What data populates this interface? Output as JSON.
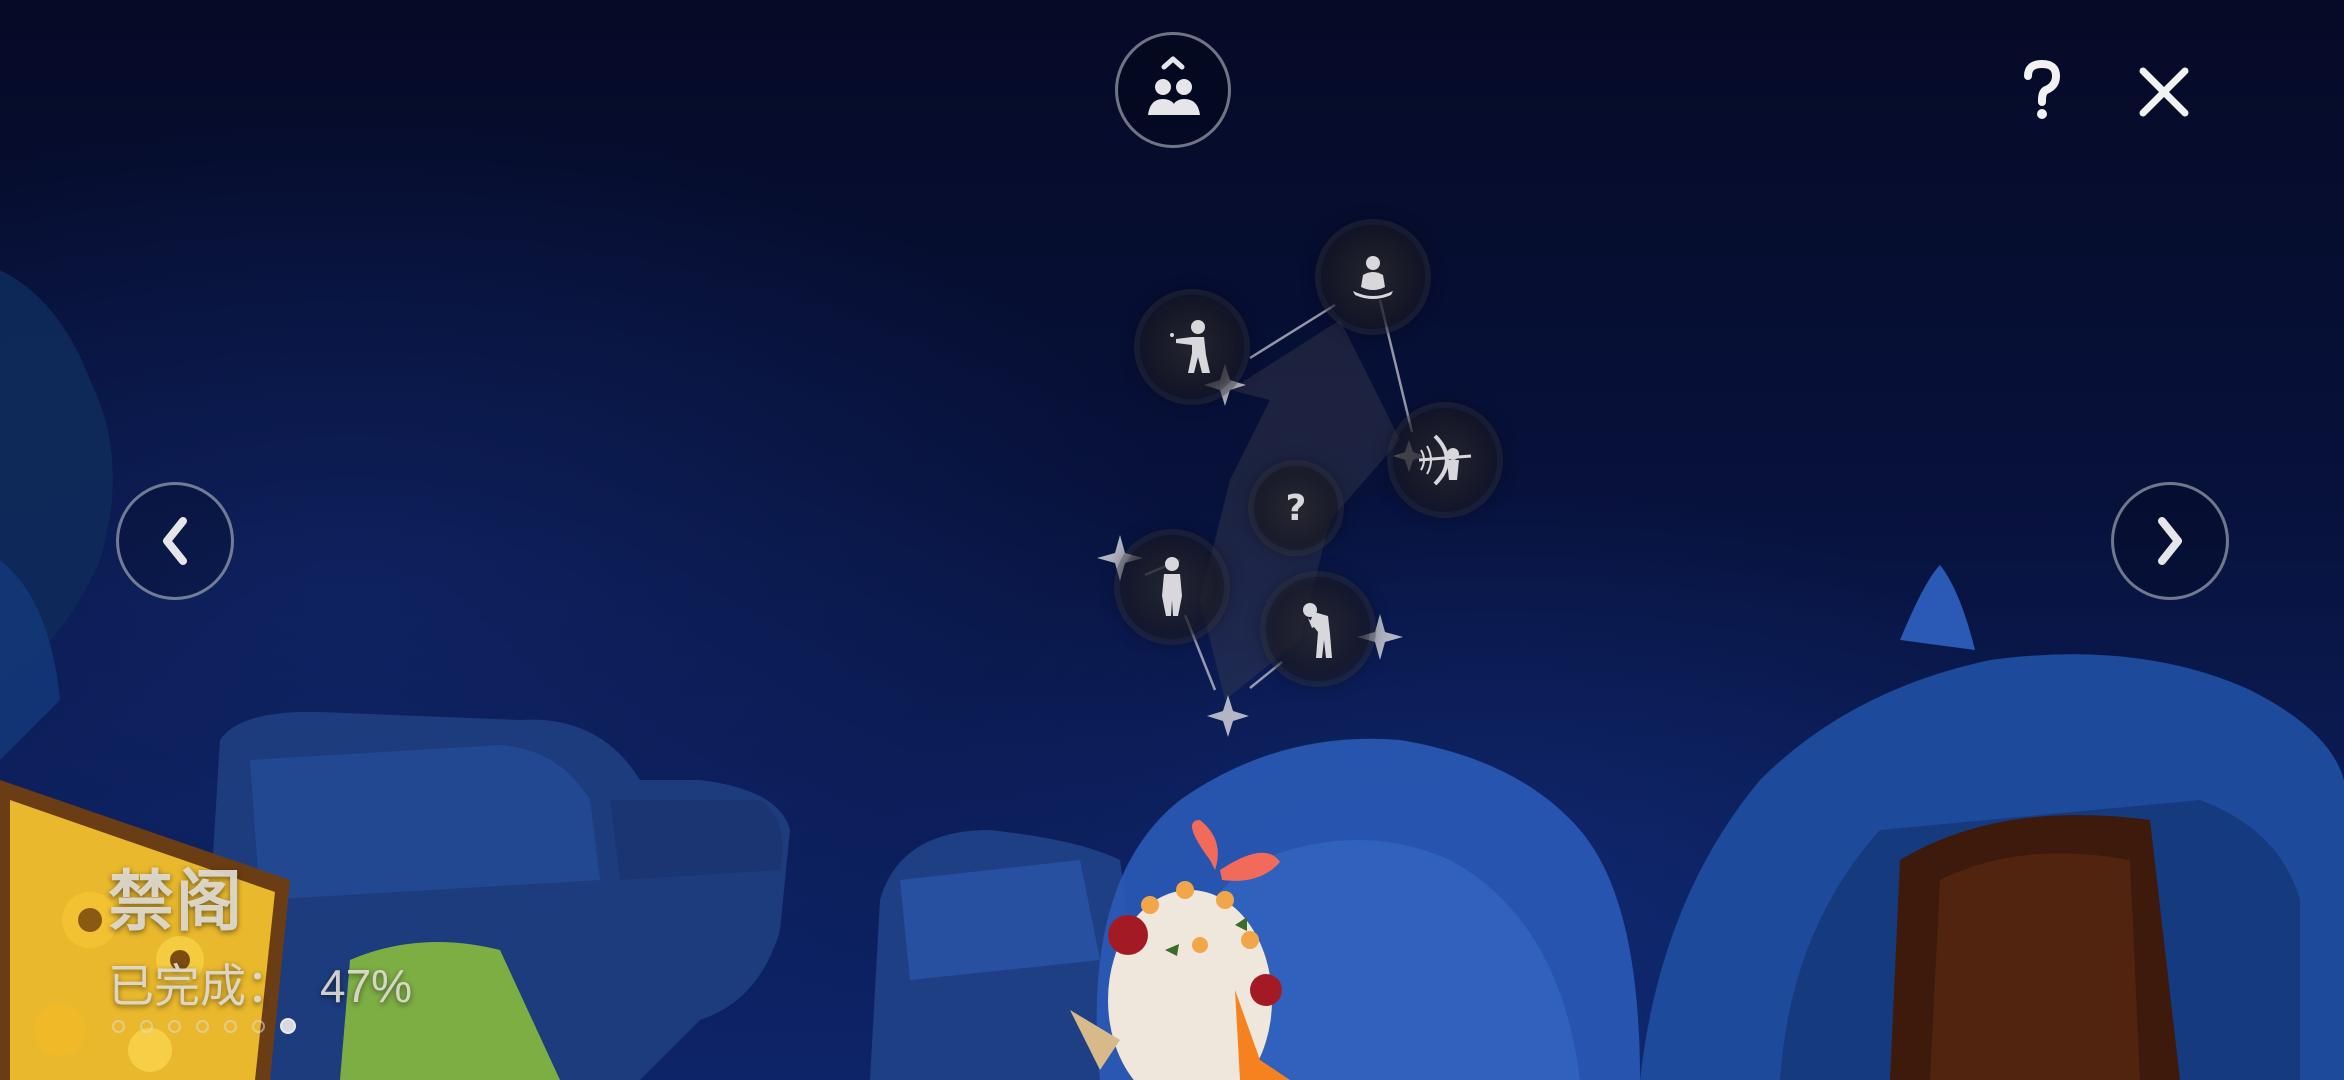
{
  "area": {
    "title": "禁阁",
    "progress_label": "已完成：",
    "progress_value": "47%",
    "progress_fraction": 0.47
  },
  "pager": {
    "count": 7,
    "active_index": 6
  },
  "top_bar": {
    "friends_icon": "people-icon",
    "help_icon": "question-icon",
    "close_icon": "close-icon"
  },
  "navigation": {
    "prev_icon": "chevron-left-icon",
    "next_icon": "chevron-right-icon"
  },
  "constellation": {
    "nodes": [
      {
        "name": "spirit-meditating",
        "icon": "meditate-icon"
      },
      {
        "name": "spirit-pointing",
        "icon": "point-icon"
      },
      {
        "name": "spirit-archer",
        "icon": "bow-icon"
      },
      {
        "name": "spirit-unknown",
        "icon": "question-icon",
        "label": "?"
      },
      {
        "name": "spirit-standing",
        "icon": "stand-icon"
      },
      {
        "name": "spirit-bowing",
        "icon": "bow-down-icon"
      }
    ]
  },
  "colors": {
    "sky_top": "#050a26",
    "sky_bottom": "#0d2468",
    "rock_blue": "#1f4a9a",
    "button_ring": "#c8cdd7"
  }
}
